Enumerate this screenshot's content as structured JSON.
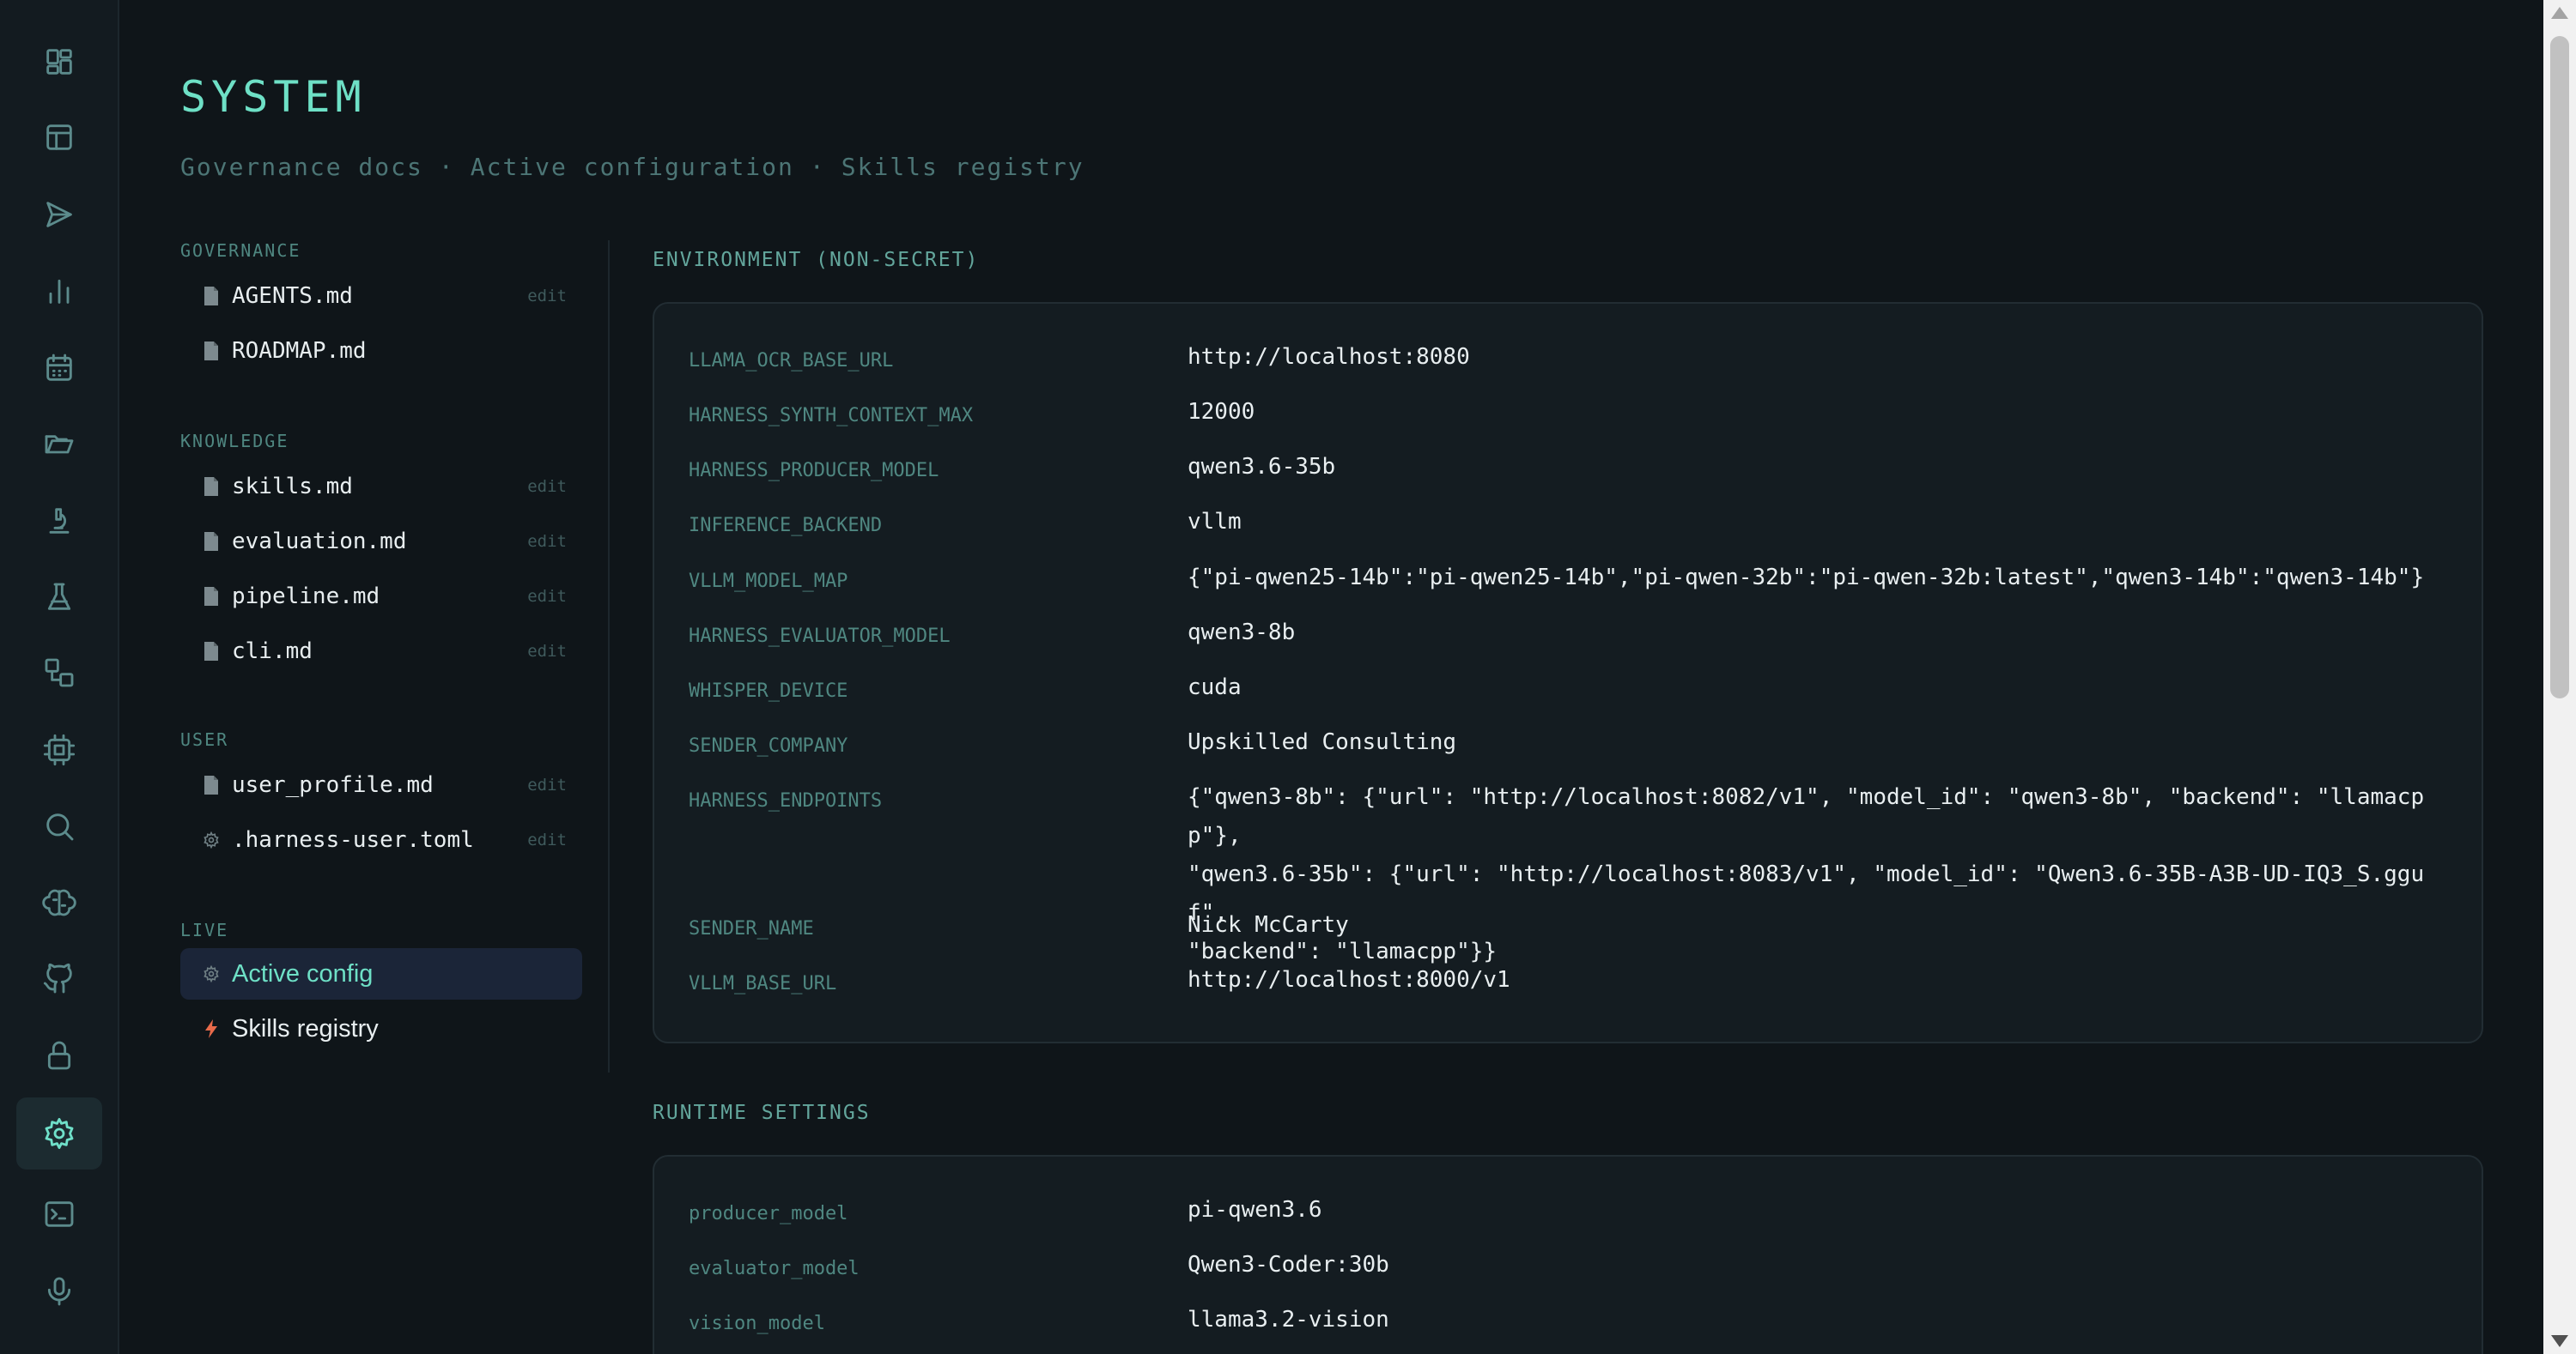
{
  "rail": [
    {
      "icon": "dashboard-icon"
    },
    {
      "icon": "table-icon"
    },
    {
      "icon": "send-icon"
    },
    {
      "icon": "bar-chart-icon"
    },
    {
      "icon": "calendar-icon"
    },
    {
      "icon": "folder-open-icon"
    },
    {
      "icon": "microscope-icon"
    },
    {
      "icon": "flask-icon"
    },
    {
      "icon": "workflow-icon"
    },
    {
      "icon": "cpu-icon"
    },
    {
      "icon": "search-icon"
    },
    {
      "icon": "brain-icon"
    },
    {
      "icon": "github-icon"
    },
    {
      "icon": "lock-icon"
    },
    {
      "icon": "gear-icon",
      "active": true
    },
    {
      "icon": "terminal-icon"
    },
    {
      "icon": "microphone-icon"
    }
  ],
  "header": {
    "title": "SYSTEM",
    "subtitle_parts": [
      "Governance docs",
      "Active configuration",
      "Skills registry"
    ],
    "separator": "·"
  },
  "sidebar": {
    "sections": [
      {
        "label": "GOVERNANCE",
        "items": [
          {
            "name": "AGENTS.md",
            "icon": "file-icon",
            "action": "edit"
          },
          {
            "name": "ROADMAP.md",
            "icon": "file-icon",
            "action": ""
          }
        ]
      },
      {
        "label": "KNOWLEDGE",
        "items": [
          {
            "name": "skills.md",
            "icon": "file-icon",
            "action": "edit"
          },
          {
            "name": "evaluation.md",
            "icon": "file-icon",
            "action": "edit"
          },
          {
            "name": "pipeline.md",
            "icon": "file-icon",
            "action": "edit"
          },
          {
            "name": "cli.md",
            "icon": "file-icon",
            "action": "edit"
          }
        ]
      },
      {
        "label": "USER",
        "items": [
          {
            "name": "user_profile.md",
            "icon": "file-icon",
            "action": "edit"
          },
          {
            "name": ".harness-user.toml",
            "icon": "gear-icon",
            "action": "edit"
          }
        ]
      },
      {
        "label": "LIVE",
        "items": [
          {
            "name": "Active config",
            "icon": "gear-icon",
            "action": "",
            "active": true
          },
          {
            "name": "Skills registry",
            "icon": "lightning-icon",
            "action": ""
          }
        ]
      }
    ]
  },
  "environment": {
    "title": "ENVIRONMENT (NON-SECRET)",
    "rows": [
      {
        "key": "LLAMA_OCR_BASE_URL",
        "value": "http://localhost:8080"
      },
      {
        "key": "HARNESS_SYNTH_CONTEXT_MAX",
        "value": "12000"
      },
      {
        "key": "HARNESS_PRODUCER_MODEL",
        "value": "qwen3.6-35b"
      },
      {
        "key": "INFERENCE_BACKEND",
        "value": "vllm"
      },
      {
        "key": "VLLM_MODEL_MAP",
        "value": "{\"pi-qwen25-14b\":\"pi-qwen25-14b\",\"pi-qwen-32b\":\"pi-qwen-32b:latest\",\"qwen3-14b\":\"qwen3-14b\"}"
      },
      {
        "key": "HARNESS_EVALUATOR_MODEL",
        "value": "qwen3-8b"
      },
      {
        "key": "WHISPER_DEVICE",
        "value": "cuda"
      },
      {
        "key": "SENDER_COMPANY",
        "value": "Upskilled Consulting"
      },
      {
        "key": "HARNESS_ENDPOINTS",
        "value": "{\"qwen3-8b\": {\"url\": \"http://localhost:8082/v1\", \"model_id\": \"qwen3-8b\", \"backend\": \"llamacpp\"},\n\"qwen3.6-35b\": {\"url\": \"http://localhost:8083/v1\", \"model_id\": \"Qwen3.6-35B-A3B-UD-IQ3_S.gguf\",\n\"backend\": \"llamacpp\"}}"
      },
      {
        "key": "SENDER_NAME",
        "value": "Nick McCarty"
      },
      {
        "key": "VLLM_BASE_URL",
        "value": "http://localhost:8000/v1"
      }
    ]
  },
  "runtime": {
    "title": "RUNTIME SETTINGS",
    "rows": [
      {
        "key": "producer_model",
        "value": "pi-qwen3.6"
      },
      {
        "key": "evaluator_model",
        "value": "Qwen3-Coder:30b"
      },
      {
        "key": "vision_model",
        "value": "llama3.2-vision"
      }
    ]
  }
}
